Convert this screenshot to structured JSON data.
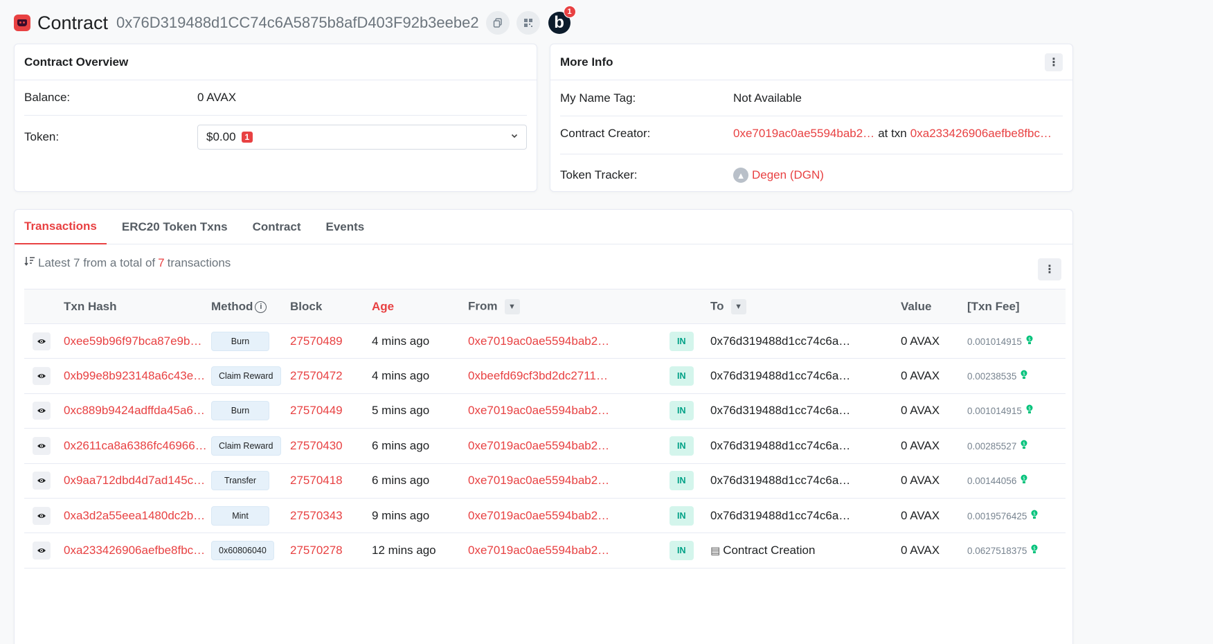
{
  "header": {
    "title": "Contract",
    "address": "0x76D319488d1CC74c6A5875b8afD403F92b3eebe2",
    "b_badge": "b",
    "b_badge_count": "1"
  },
  "overview": {
    "title": "Contract Overview",
    "balance_label": "Balance:",
    "balance_value": "0 AVAX",
    "token_label": "Token:",
    "token_value": "$0.00",
    "token_count": "1"
  },
  "more_info": {
    "title": "More Info",
    "name_tag_label": "My Name Tag:",
    "name_tag_value": "Not Available",
    "creator_label": "Contract Creator:",
    "creator_address": "0xe7019ac0ae5594bab2…",
    "creator_at": "at txn",
    "creator_txn": "0xa233426906aefbe8fbc…",
    "tracker_label": "Token Tracker:",
    "tracker_value": "Degen (DGN)"
  },
  "tabs": [
    "Transactions",
    "ERC20 Token Txns",
    "Contract",
    "Events"
  ],
  "summary": {
    "prefix": "Latest 7 from a total of",
    "count": "7",
    "suffix": "transactions"
  },
  "table": {
    "headers": {
      "txn_hash": "Txn Hash",
      "method": "Method",
      "block": "Block",
      "age": "Age",
      "from": "From",
      "to": "To",
      "value": "Value",
      "fee": "[Txn Fee]"
    },
    "rows": [
      {
        "hash": "0xee59b96f97bca87e9b…",
        "method": "Burn",
        "block": "27570489",
        "age": "4 mins ago",
        "from": "0xe7019ac0ae5594bab2…",
        "dir": "IN",
        "to": "0x76d319488d1cc74c6a…",
        "value": "0 AVAX",
        "fee": "0.001014915"
      },
      {
        "hash": "0xb99e8b923148a6c43e…",
        "method": "Claim Reward",
        "block": "27570472",
        "age": "4 mins ago",
        "from": "0xbeefd69cf3bd2dc2711…",
        "dir": "IN",
        "to": "0x76d319488d1cc74c6a…",
        "value": "0 AVAX",
        "fee": "0.00238535"
      },
      {
        "hash": "0xc889b9424adffda45a6…",
        "method": "Burn",
        "block": "27570449",
        "age": "5 mins ago",
        "from": "0xe7019ac0ae5594bab2…",
        "dir": "IN",
        "to": "0x76d319488d1cc74c6a…",
        "value": "0 AVAX",
        "fee": "0.001014915"
      },
      {
        "hash": "0x2611ca8a6386fc46966…",
        "method": "Claim Reward",
        "block": "27570430",
        "age": "6 mins ago",
        "from": "0xe7019ac0ae5594bab2…",
        "dir": "IN",
        "to": "0x76d319488d1cc74c6a…",
        "value": "0 AVAX",
        "fee": "0.00285527"
      },
      {
        "hash": "0x9aa712dbd4d7ad145c…",
        "method": "Transfer",
        "block": "27570418",
        "age": "6 mins ago",
        "from": "0xe7019ac0ae5594bab2…",
        "dir": "IN",
        "to": "0x76d319488d1cc74c6a…",
        "value": "0 AVAX",
        "fee": "0.00144056"
      },
      {
        "hash": "0xa3d2a55eea1480dc2b…",
        "method": "Mint",
        "block": "27570343",
        "age": "9 mins ago",
        "from": "0xe7019ac0ae5594bab2…",
        "dir": "IN",
        "to": "0x76d319488d1cc74c6a…",
        "value": "0 AVAX",
        "fee": "0.0019576425"
      },
      {
        "hash": "0xa233426906aefbe8fbc…",
        "method": "0x60806040",
        "block": "27570278",
        "age": "12 mins ago",
        "from": "0xe7019ac0ae5594bab2…",
        "dir": "IN",
        "to": "Contract Creation",
        "to_is_creation": true,
        "value": "0 AVAX",
        "fee": "0.0627518375"
      }
    ]
  },
  "colors": {
    "accent": "#e84142",
    "in_badge_bg": "#d4f5ec",
    "in_badge_text": "#00a186"
  }
}
